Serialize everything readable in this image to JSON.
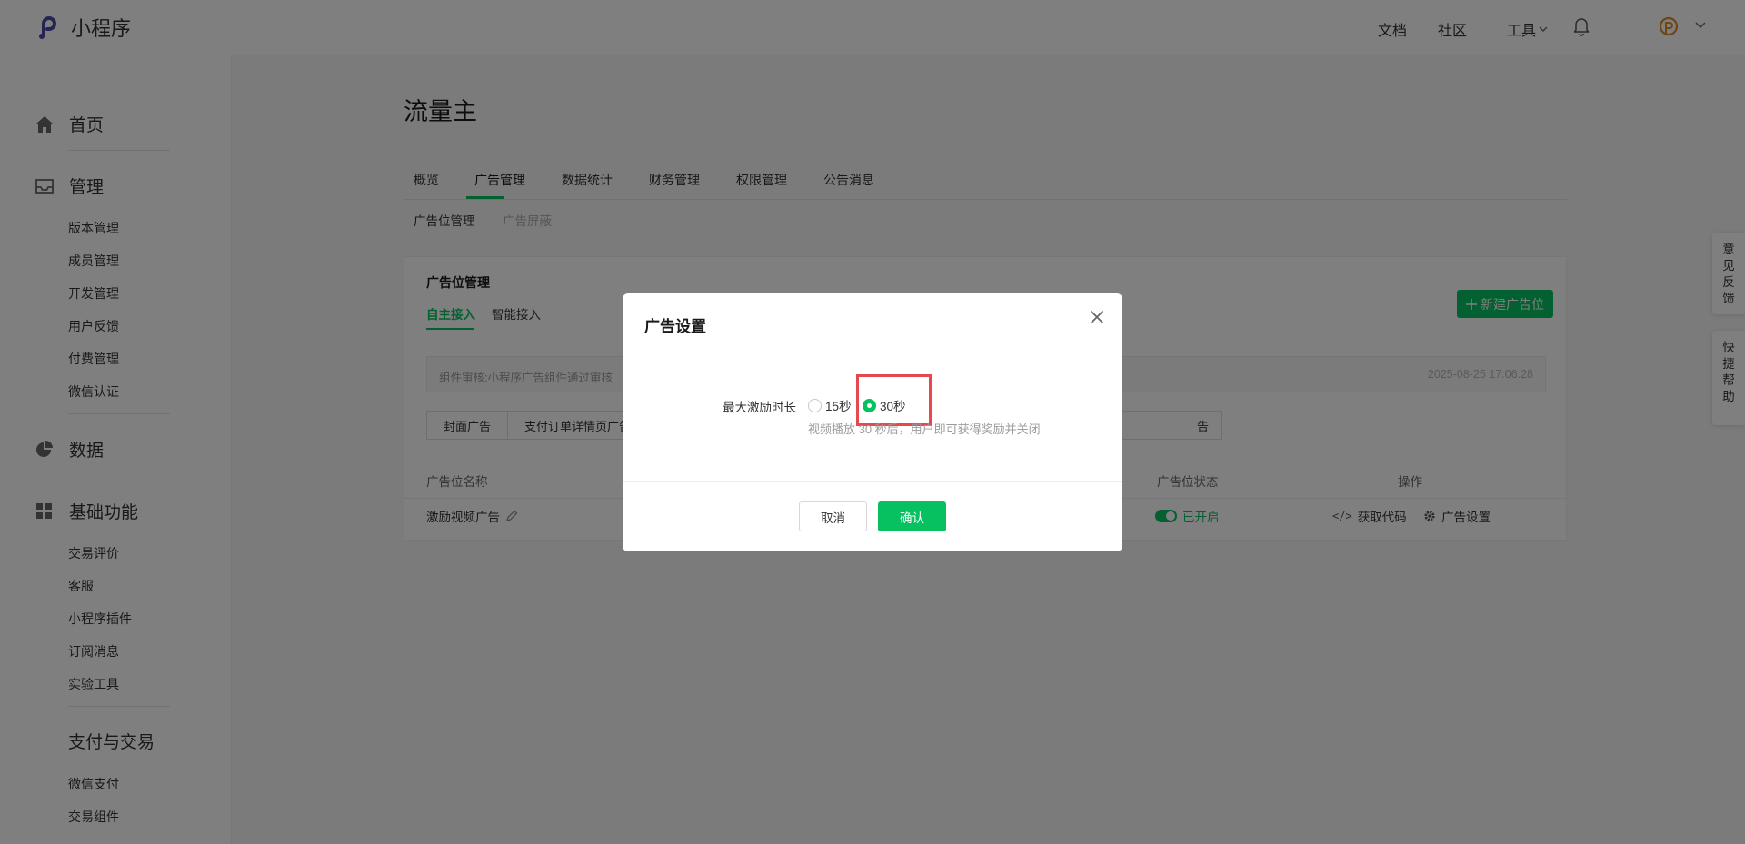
{
  "app": {
    "logo_text": "小程序",
    "top_nav": {
      "docs": "文档",
      "community": "社区",
      "tools": "工具"
    }
  },
  "sidebar": {
    "home": "首页",
    "manage": {
      "label": "管理",
      "items": [
        "版本管理",
        "成员管理",
        "开发管理",
        "用户反馈",
        "付费管理",
        "微信认证"
      ]
    },
    "data": "数据",
    "basic": {
      "label": "基础功能",
      "items": [
        "交易评价",
        "客服",
        "小程序插件",
        "订阅消息",
        "实验工具"
      ]
    },
    "pay": {
      "label": "支付与交易",
      "items": [
        "微信支付",
        "交易组件"
      ]
    }
  },
  "main": {
    "title": "流量主",
    "tabs": [
      "概览",
      "广告管理",
      "数据统计",
      "财务管理",
      "权限管理",
      "公告消息"
    ],
    "subtabs": [
      "广告位管理",
      "广告屏蔽"
    ],
    "card": {
      "title": "广告位管理",
      "tabs": [
        "自主接入",
        "智能接入"
      ],
      "new_button": "新建广告位",
      "notice": "组件审核:小程序广告组件通过审核",
      "notice_time": "2025-08-25 17:06:28",
      "segments": [
        "封面广告",
        "支付订单详情页广告"
      ],
      "segment_tail": "告",
      "columns": {
        "name": "广告位名称",
        "status": "广告位状态",
        "actions": "操作"
      },
      "row": {
        "name": "激励视频广告",
        "status": "已开启",
        "get_code": "获取代码",
        "settings": "广告设置"
      }
    }
  },
  "float": {
    "feedback": "意见反馈",
    "help": "快捷帮助"
  },
  "modal": {
    "title": "广告设置",
    "field_label": "最大激励时长",
    "options": [
      "15秒",
      "30秒"
    ],
    "selected": "30秒",
    "hint": "视频播放 30 秒后，用户即可获得奖励并关闭",
    "cancel": "取消",
    "confirm": "确认"
  },
  "colors": {
    "accent": "#07c160",
    "highlight": "#e5484d"
  }
}
